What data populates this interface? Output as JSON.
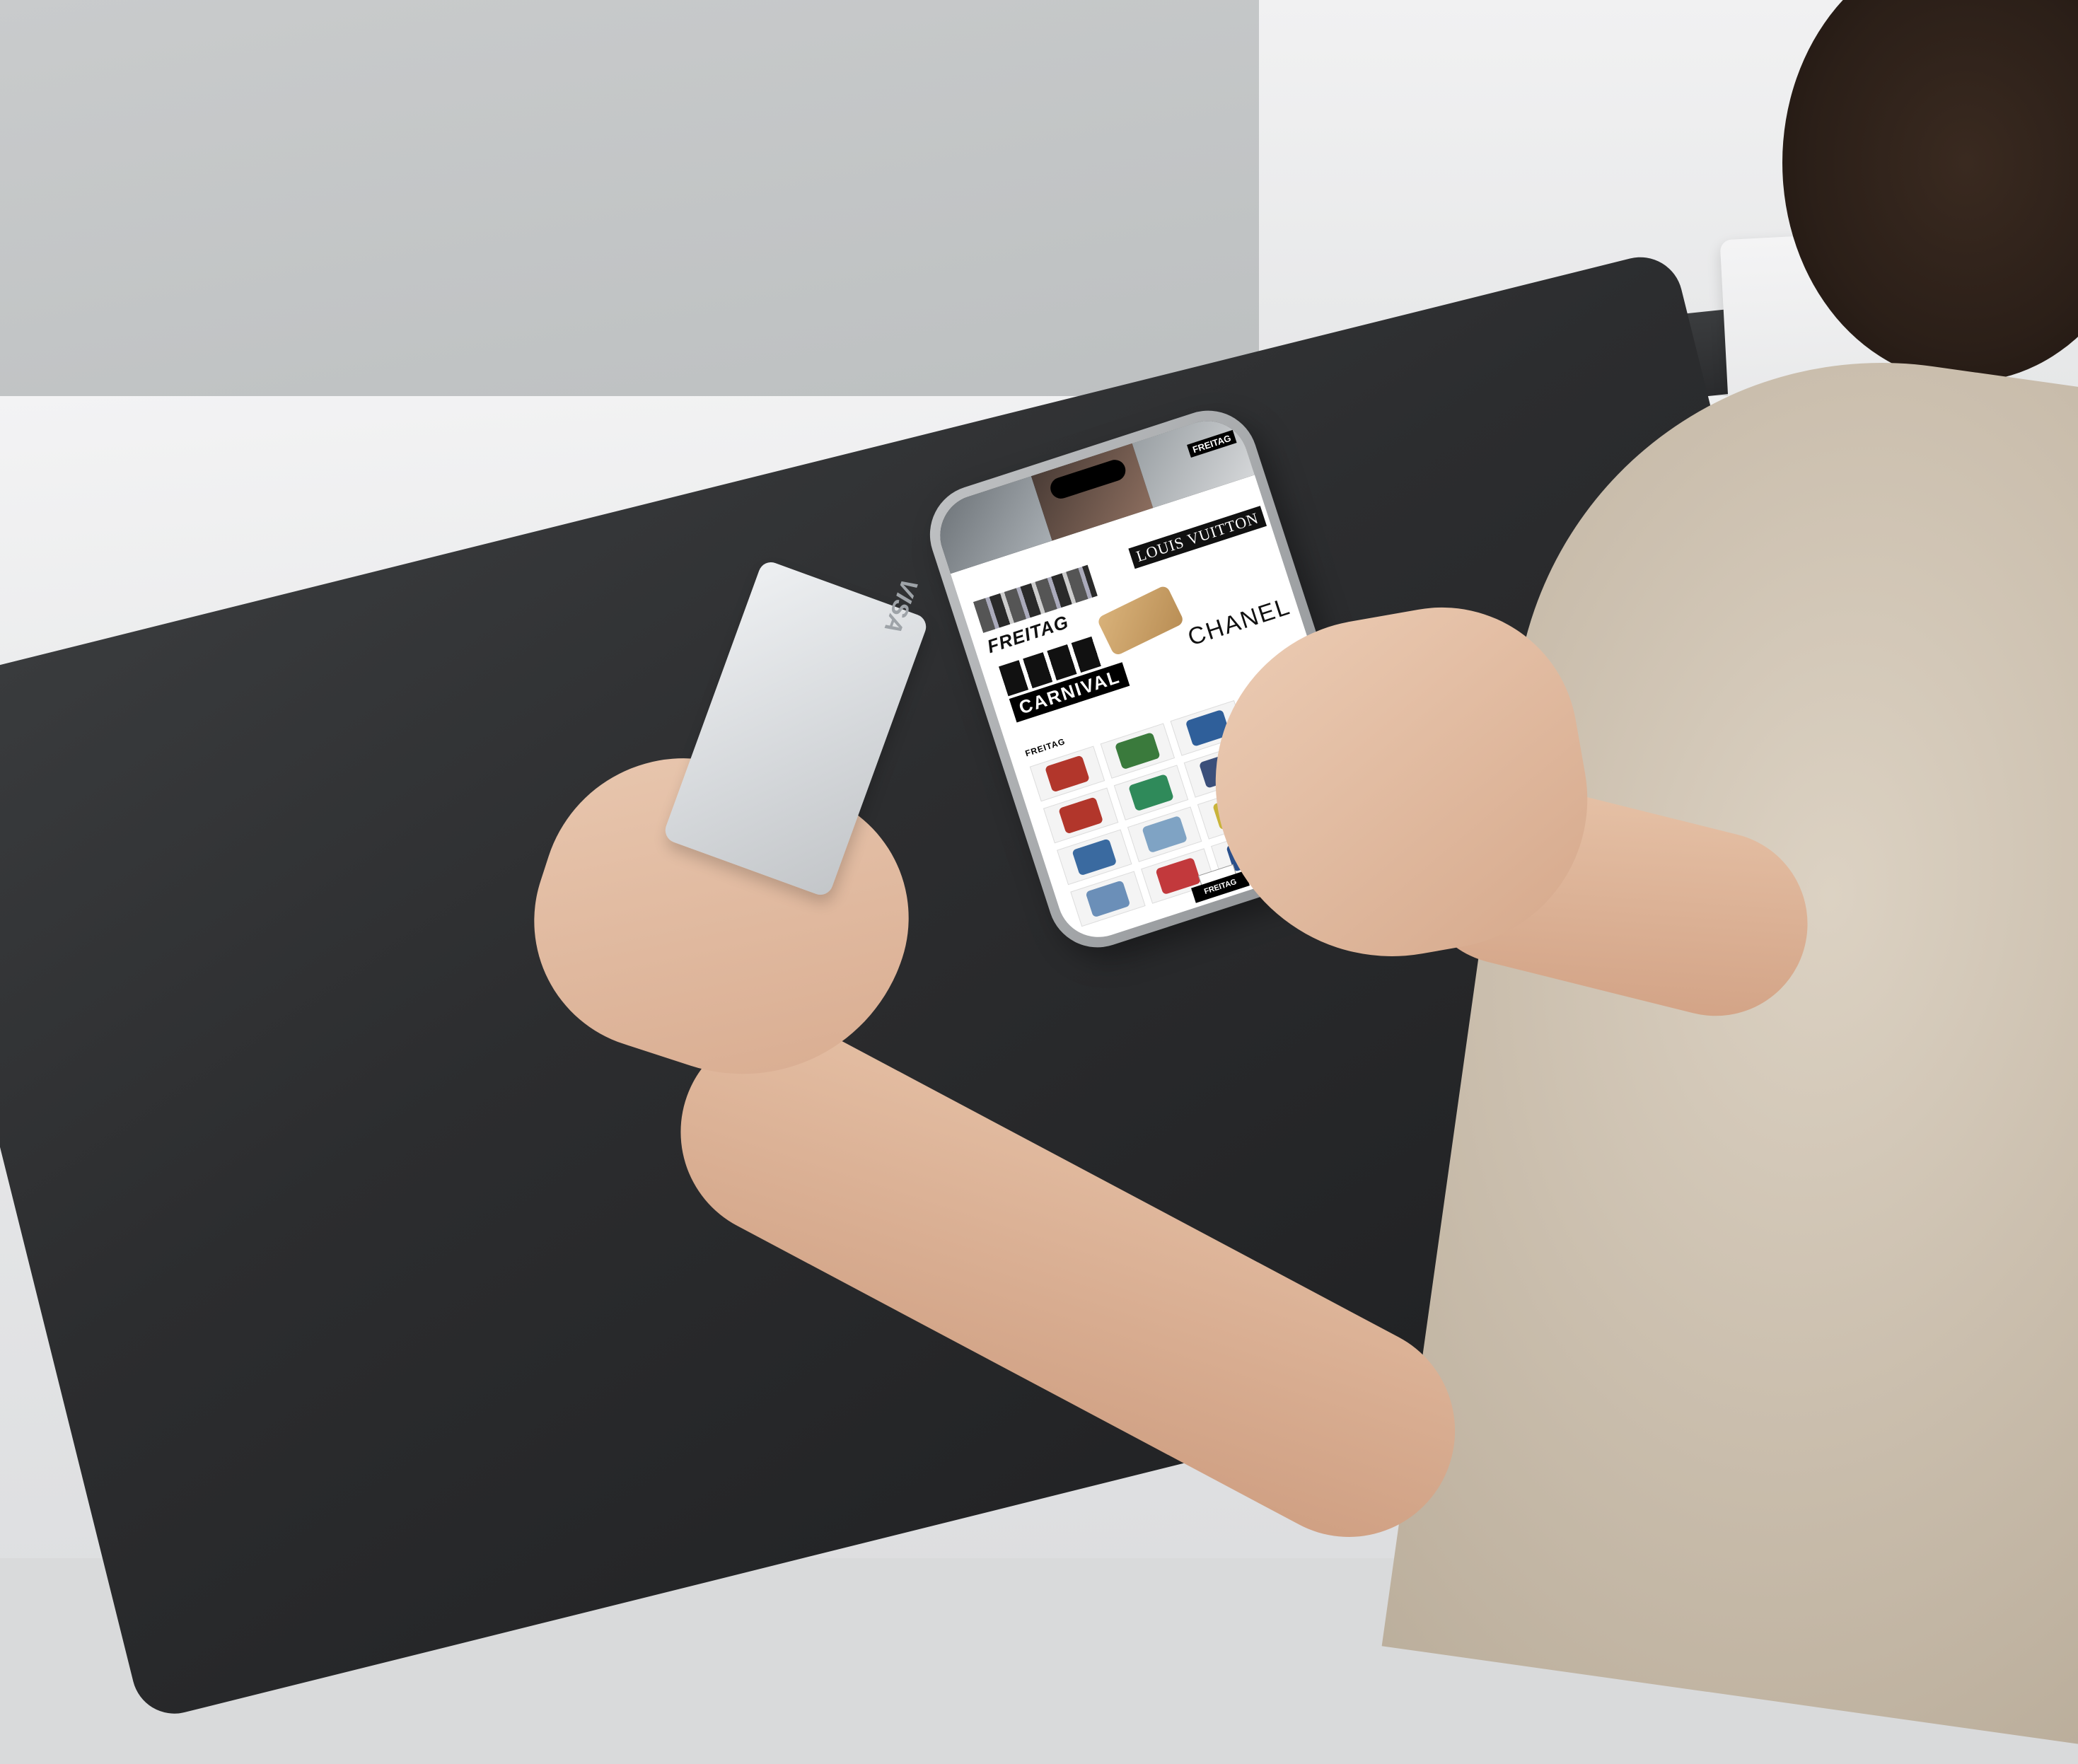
{
  "card": {
    "brand": "VISA"
  },
  "phone": {
    "banner": {
      "brand_tag": "FREITAG"
    },
    "collage": {
      "louis_vuitton": "LOUIS VUITTON",
      "freitag": "FREITAG",
      "carnival": "CARNIVAL",
      "chanel": "CHANEL"
    },
    "section_heading": "FREITAG",
    "tiles": [
      "#b2362b",
      "#3a7a3c",
      "#2f5f9a",
      "#c24a3d",
      "#b2362b",
      "#2f8a5a",
      "#3b4f7a",
      "#7b7b7b",
      "#3a6aa0",
      "#7fa3c4",
      "#c9b33a",
      "#2b2b2b",
      "#6b8fb8",
      "#c2393c",
      "#2a4f8a",
      "#5f7d9a"
    ],
    "footer_logo": "FREITAG"
  }
}
